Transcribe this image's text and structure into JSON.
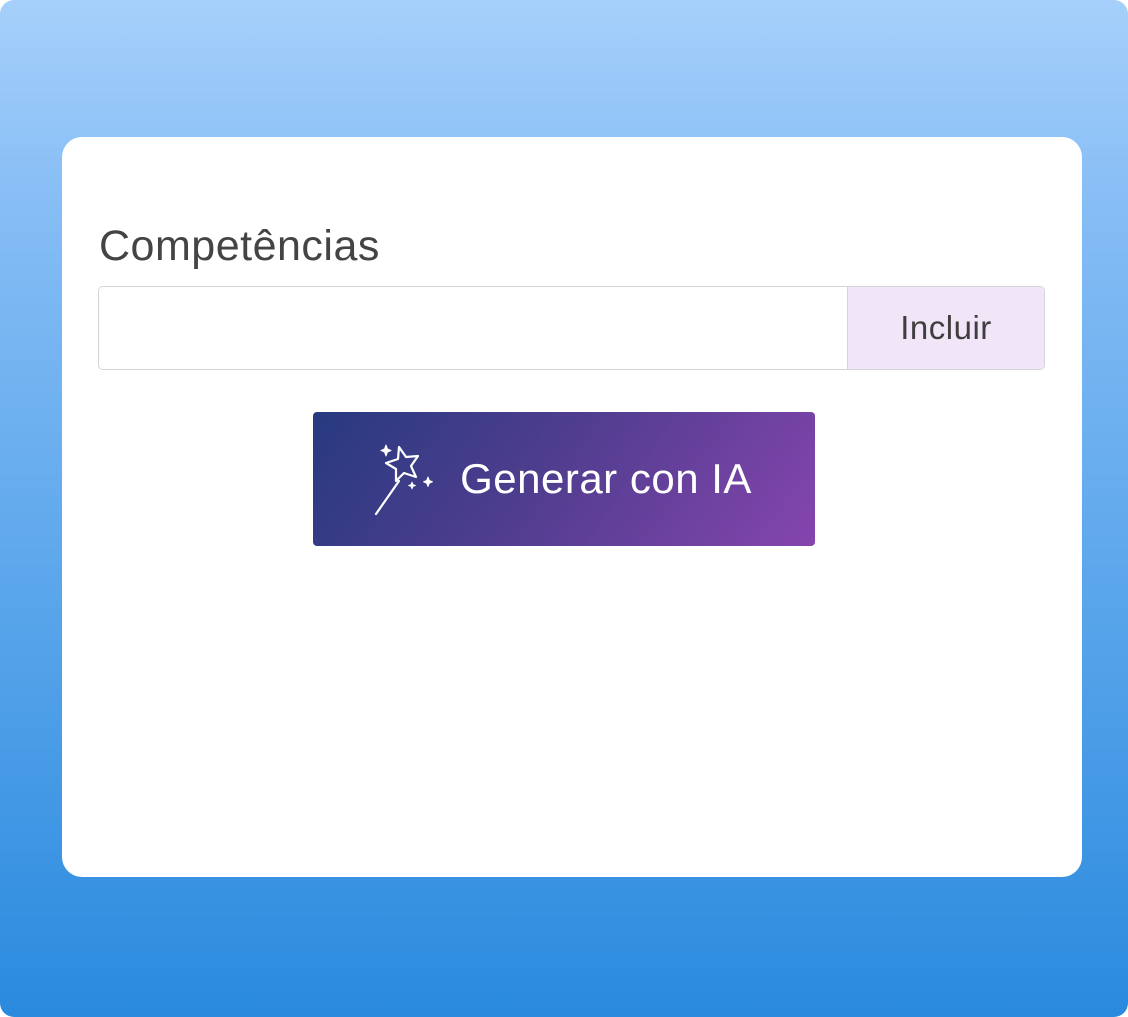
{
  "form": {
    "field_label": "Competências",
    "input_value": "",
    "input_placeholder": "",
    "add_button_label": "Incluir",
    "ai_button_label": "Generar con IA",
    "ai_button_icon": "magic-wand-icon"
  },
  "colors": {
    "background_top": "#a6d0fb",
    "background_bottom": "#2a8ade",
    "card": "#ffffff",
    "add_button_bg": "#f1e5f8",
    "ai_button_gradient_start": "#273a80",
    "ai_button_gradient_end": "#8545ae",
    "label_text": "#444444"
  }
}
